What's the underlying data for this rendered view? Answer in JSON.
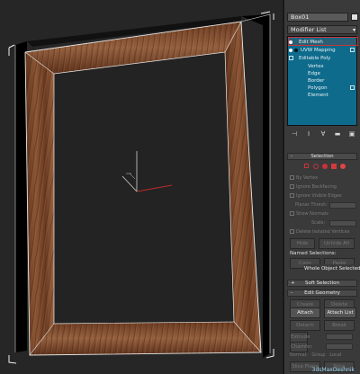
{
  "colors": {
    "viewport_bg": "#262626",
    "panel_bg": "#3a3a3a",
    "stack_bg": "#0e6b8c",
    "highlight_red": "#c8333a",
    "wood_dark": "#5a301a",
    "wood_light": "#9a6443",
    "axis_x": "#c02b2b",
    "axis_y": "#cfcfcf"
  },
  "object": {
    "name": "Box01"
  },
  "modifier_list": {
    "label": "Modifier List"
  },
  "modifier_stack": [
    {
      "label": "Edit Mesh",
      "highlighted": true
    },
    {
      "label": "UVW Mapping",
      "highlighted": false
    },
    {
      "label": "Editable Poly",
      "highlighted": false
    },
    {
      "label": "Vertex",
      "highlighted": false
    },
    {
      "label": "Edge",
      "highlighted": false
    },
    {
      "label": "Border",
      "highlighted": false
    },
    {
      "label": "Polygon",
      "highlighted": false
    },
    {
      "label": "Element",
      "highlighted": false
    }
  ],
  "stack_tools": [
    "pin-stack-icon",
    "show-end-result-icon",
    "make-unique-icon",
    "remove-modifier-icon",
    "configure-sets-icon"
  ],
  "rollouts": {
    "selection": "Selection",
    "soft_selection": "Soft Selection",
    "edit_geometry": "Edit Geometry"
  },
  "selection_options": {
    "by_vertex": "By Vertex",
    "ignore_backfacing": "Ignore Backfacing",
    "ignore_visible_edges": "Ignore Visible Edges",
    "planar_thresh": "Planar Thresh:",
    "show_normals": "Show Normals",
    "scale": "Scale:",
    "delete_isolated": "Delete Isolated Vertices",
    "hide": "Hide",
    "unhide_all": "Unhide All"
  },
  "named_selections": {
    "label": "Named Selections:",
    "copy": "Copy",
    "paste": "Paste",
    "whole_object_selected": "Whole Object Selected"
  },
  "edit_geometry": {
    "create": "Create",
    "delete": "Delete",
    "attach": "Attach",
    "attach_list": "Attach List",
    "detach": "Detach",
    "break": "Break",
    "turn": "Turn",
    "extrude": "Extrude",
    "chamfer": "Chamfer",
    "normal": "Normal:",
    "group": "Group",
    "local": "Local",
    "slice_plane": "Slice Plane",
    "slice": "Slice"
  },
  "watermark": "3dsMaxDeshnik"
}
